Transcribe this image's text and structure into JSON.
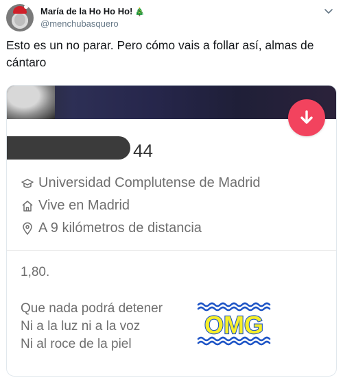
{
  "tweet": {
    "display_name": "María de la Ho Ho Ho!",
    "name_emoji_icon": "christmas-tree-icon",
    "handle": "@menchubasquero",
    "text": "Esto es un no parar. Pero cómo vais a follar así, almas de cántaro"
  },
  "profile_card": {
    "age": "44",
    "info": [
      {
        "icon": "graduation-cap-icon",
        "text": "Universidad Complutense de Madrid"
      },
      {
        "icon": "home-icon",
        "text": "Vive en Madrid"
      },
      {
        "icon": "location-pin-icon",
        "text": "A 9 kilómetros de distancia"
      }
    ],
    "height": "1,80.",
    "bio_lines": [
      "Que nada podrá detener",
      "Ni a la luz ni a la voz",
      "Ni al roce de la piel"
    ],
    "sticker_text": "OMG",
    "colors": {
      "down_button": "#f2435e",
      "sticker_fill": "#f7ef2a",
      "sticker_outline": "#1d54c6"
    }
  }
}
